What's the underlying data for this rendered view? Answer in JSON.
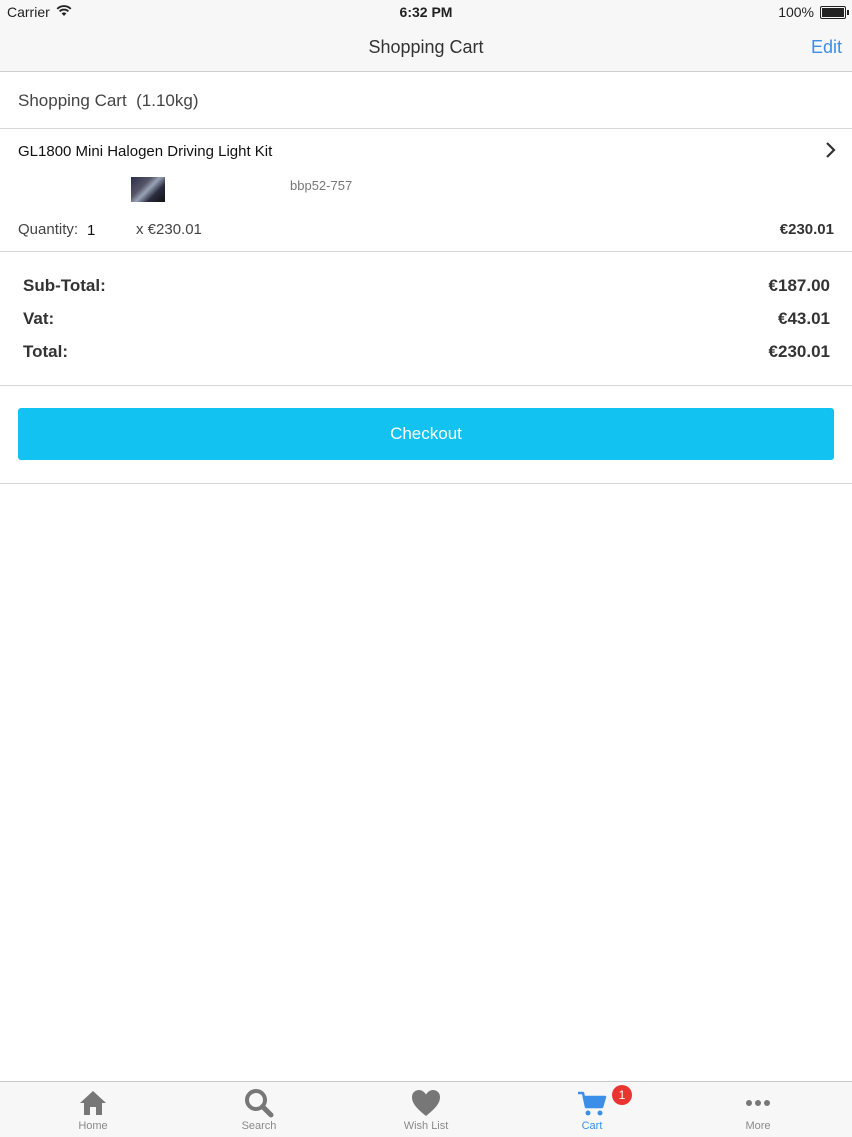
{
  "status_bar": {
    "carrier": "Carrier",
    "time": "6:32 PM",
    "battery": "100%"
  },
  "nav": {
    "title": "Shopping Cart",
    "edit_label": "Edit"
  },
  "cart_header": {
    "label": "Shopping Cart  (1.10kg)"
  },
  "item": {
    "name": "GL1800 Mini Halogen Driving Light Kit",
    "sku": "bbp52-757",
    "quantity_label": "Quantity:",
    "quantity": "1",
    "unit_price": "x €230.01",
    "line_total": "€230.01"
  },
  "totals": {
    "subtotal_label": "Sub-Total:",
    "subtotal": "€187.00",
    "vat_label": "Vat:",
    "vat": "€43.01",
    "total_label": "Total:",
    "total": "€230.01"
  },
  "checkout_label": "Checkout",
  "tabs": [
    {
      "label": "Home",
      "icon": "home-icon"
    },
    {
      "label": "Search",
      "icon": "search-icon"
    },
    {
      "label": "Wish List",
      "icon": "heart-icon"
    },
    {
      "label": "Cart",
      "icon": "cart-icon",
      "badge": "1",
      "active": true
    },
    {
      "label": "More",
      "icon": "more-icon"
    }
  ],
  "colors": {
    "accent": "#3b8fe8",
    "checkout": "#12c2f0",
    "badge": "#e8352f"
  }
}
